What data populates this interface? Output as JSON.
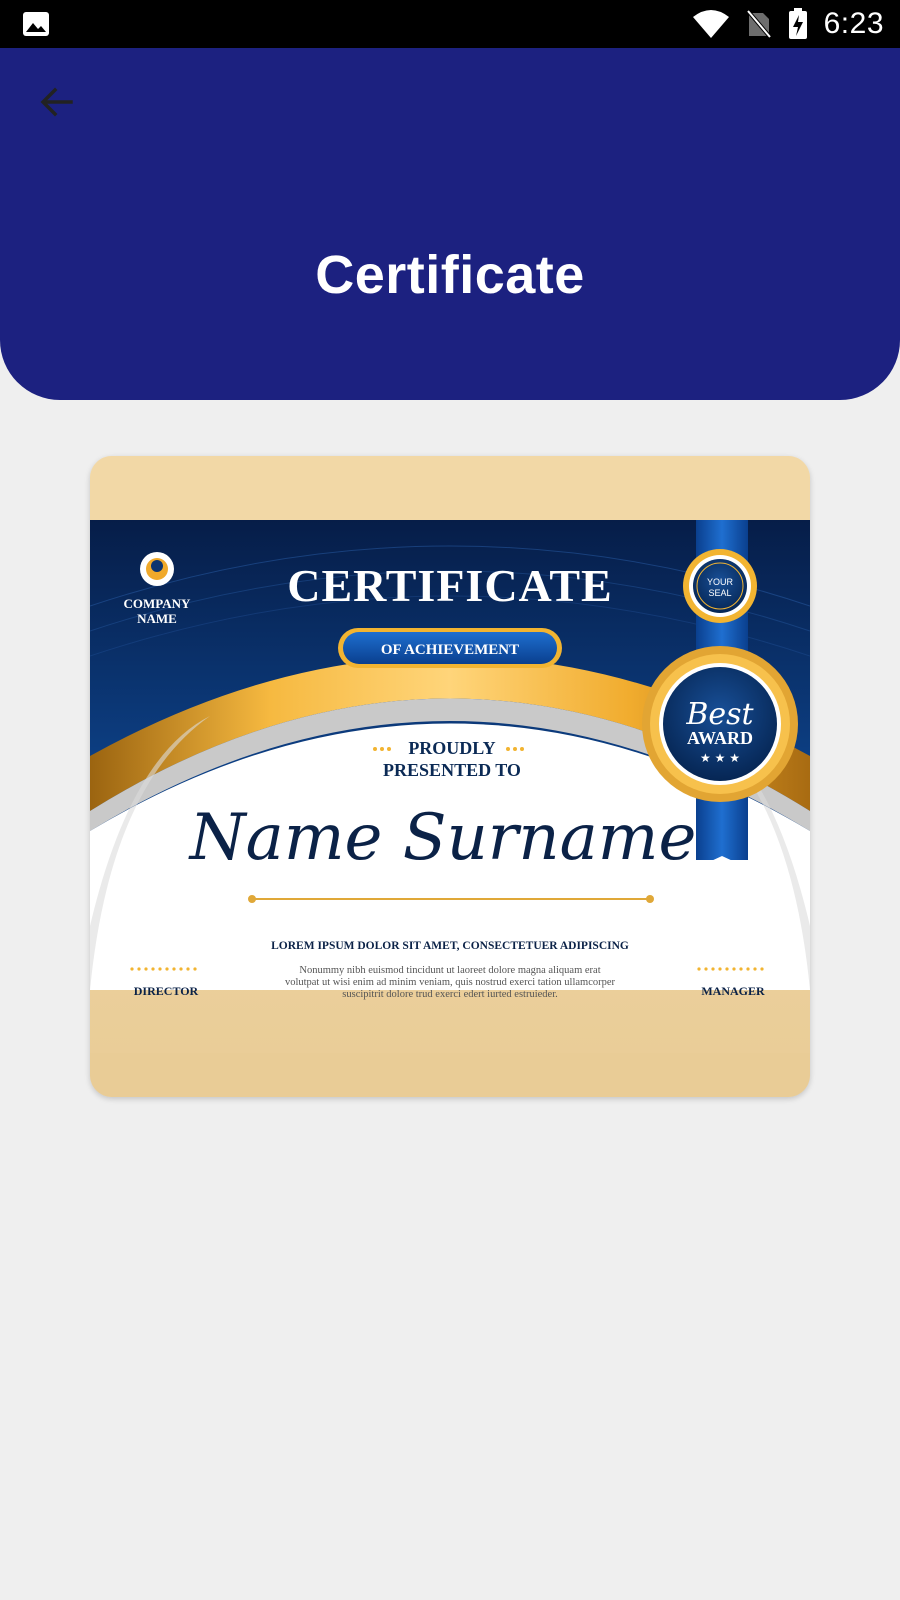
{
  "status_bar": {
    "time": "6:23",
    "icons": [
      "image-icon",
      "wifi-icon",
      "no-sim-icon",
      "battery-charging-icon"
    ]
  },
  "header": {
    "title": "Certificate",
    "back_icon": "arrow-back-icon",
    "background": "#1c2180"
  },
  "certificate": {
    "company_line1": "COMPANY",
    "company_line2": "NAME",
    "title": "CERTIFICATE",
    "subtitle": "OF ACHIEVEMENT",
    "seal_line1": "YOUR",
    "seal_line2": "SEAL",
    "award_script": "Best",
    "award_text": "AWARD",
    "award_stars": "★ ★ ★",
    "proudly": "PROUDLY",
    "presented_to": "PRESENTED TO",
    "recipient": "Name Surname",
    "lorem_heading": "LOREM IPSUM DOLOR SIT AMET, CONSECTETUER ADIPISCING",
    "body_line1": "Nonummy nibh euismod tincidunt ut laoreet dolore magna aliquam erat",
    "body_line2": "volutpat ut wisi enim ad minim veniam, quis nostrud exerci tation ullamcorper",
    "body_line3": "suscipitrit dolore trud exerci edert iurted estruieder.",
    "signature_left": "DIRECTOR",
    "signature_right": "MANAGER",
    "colors": {
      "navy": "#0b3a78",
      "gold": "#f2b431",
      "cream": "#f2d9a8"
    }
  }
}
